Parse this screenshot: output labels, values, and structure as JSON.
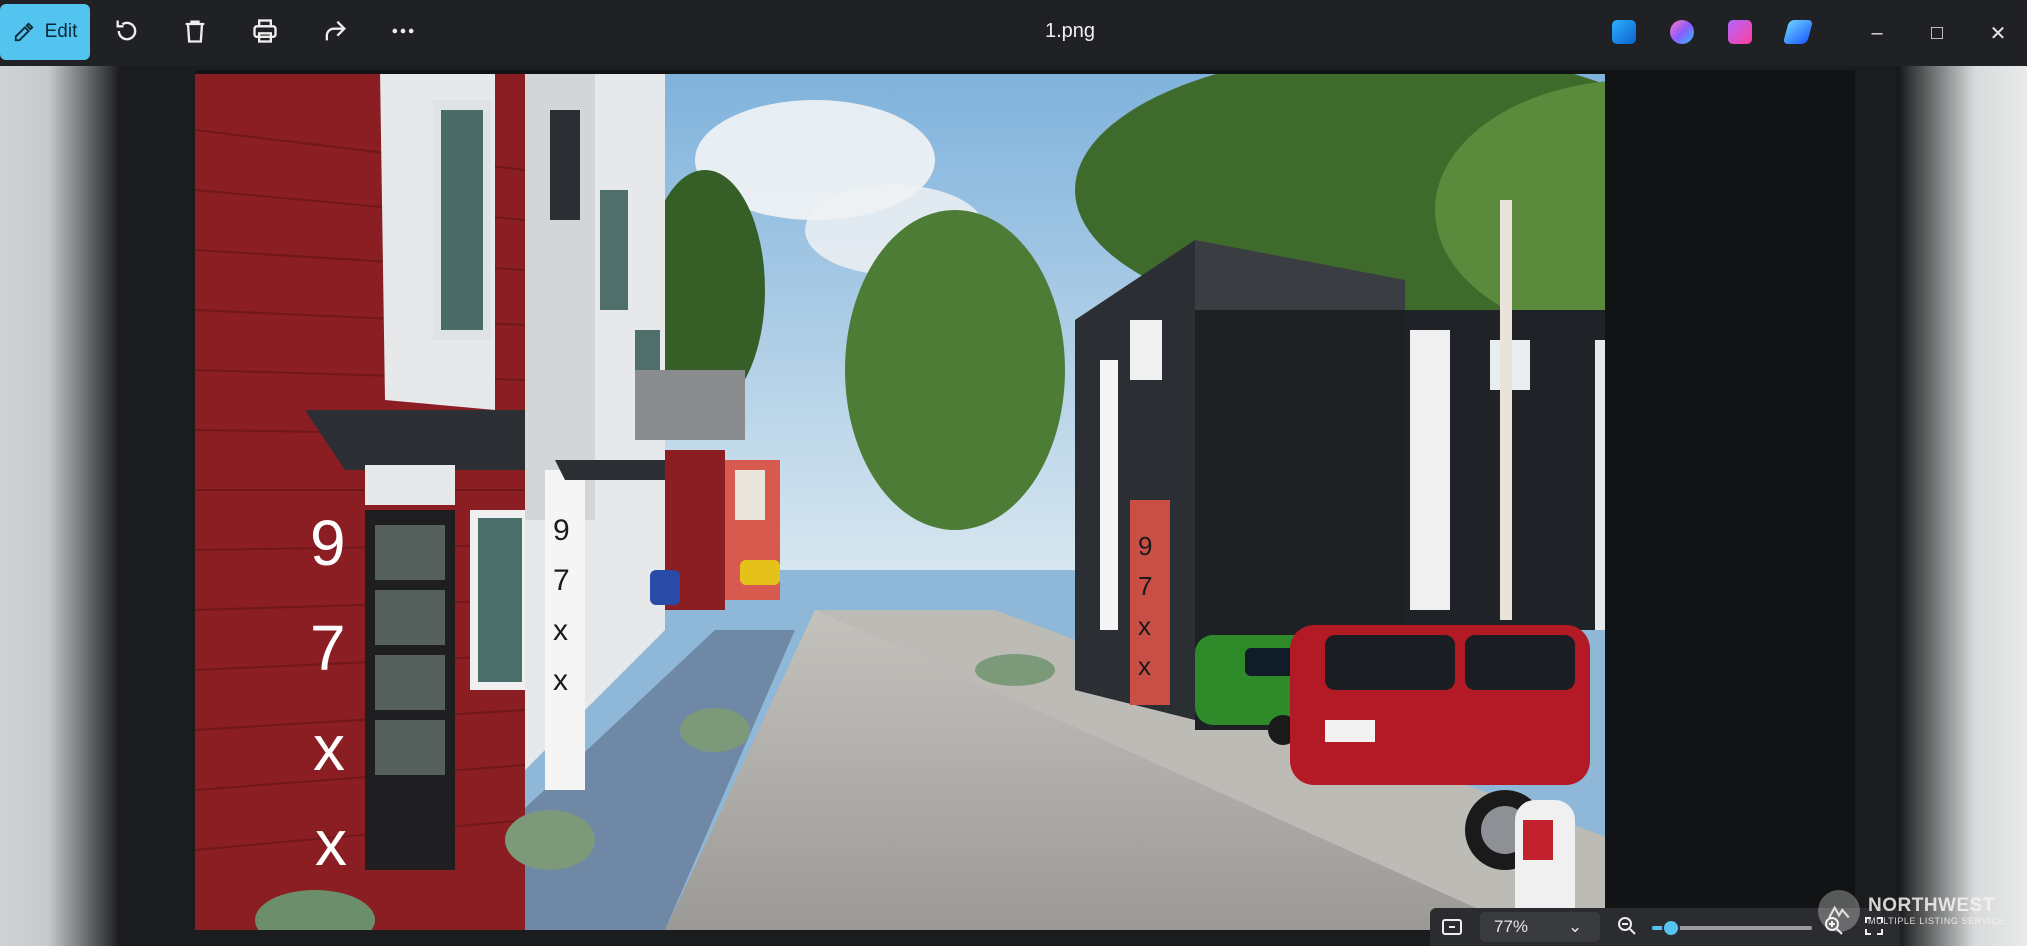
{
  "toolbar": {
    "edit_label": "Edit",
    "icons": [
      "rotate-icon",
      "delete-icon",
      "print-icon",
      "share-icon",
      "more-icon"
    ]
  },
  "window": {
    "title": "1.png",
    "apps": [
      "paint-icon",
      "copilot-icon",
      "clipchamp-icon",
      "designer-icon"
    ],
    "controls": [
      "minimize-icon",
      "maximize-icon",
      "close-icon"
    ]
  },
  "image": {
    "house_numbers": [
      "9",
      "7",
      "x",
      "x"
    ],
    "colors": {
      "sky": "#8fb8d8",
      "red_siding": "#8a1e22",
      "white_siding": "#e6e8ea",
      "charcoal_siding": "#2b2e33",
      "pavement": "#b4b2ae",
      "foliage": "#3e6b2c"
    }
  },
  "zoom": {
    "level": "77%",
    "slider_fraction": 0.12
  },
  "watermark": {
    "name": "NORTHWEST",
    "tagline": "MULTIPLE LISTING SERVICE"
  }
}
